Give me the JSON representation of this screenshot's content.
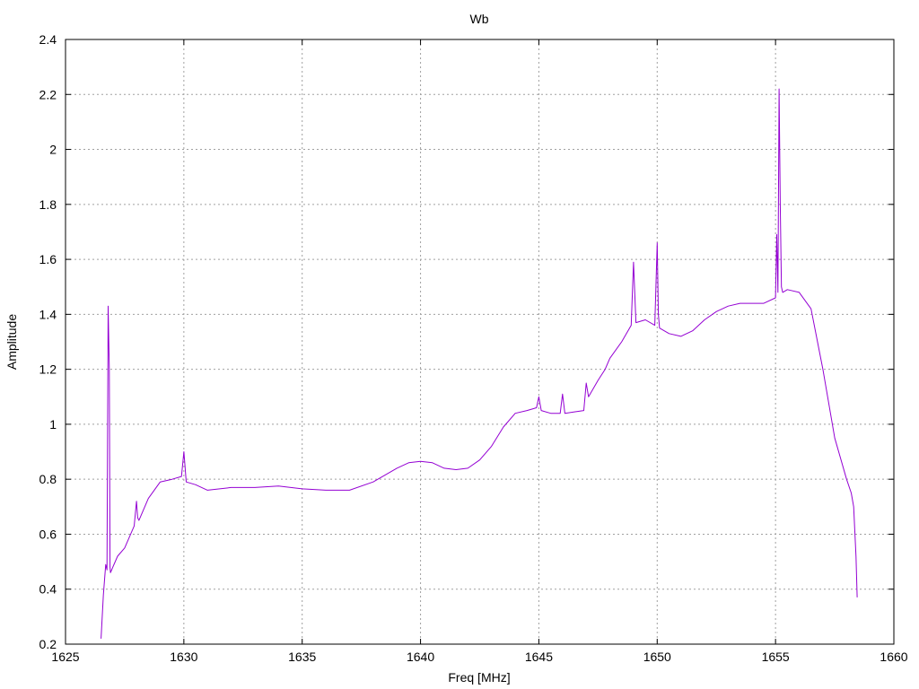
{
  "chart_data": {
    "type": "line",
    "title": "Wb",
    "xlabel": "Freq [MHz]",
    "ylabel": "Amplitude",
    "xlim": [
      1625,
      1660
    ],
    "ylim": [
      0.2,
      2.4
    ],
    "xticks": [
      1625,
      1630,
      1635,
      1640,
      1645,
      1650,
      1655,
      1660
    ],
    "yticks": [
      0.2,
      0.4,
      0.6,
      0.8,
      1,
      1.2,
      1.4,
      1.6,
      1.8,
      2,
      2.2,
      2.4
    ],
    "grid": true,
    "legend": "none",
    "series": [
      {
        "color": "#9400d3",
        "x": [
          1626.5,
          1626.6,
          1626.7,
          1626.75,
          1626.8,
          1626.85,
          1626.88,
          1626.9,
          1626.95,
          1627.0,
          1627.2,
          1627.5,
          1627.9,
          1628.0,
          1628.05,
          1628.1,
          1628.5,
          1629.0,
          1629.5,
          1629.9,
          1630.0,
          1630.1,
          1630.5,
          1631.0,
          1632.0,
          1633.0,
          1634.0,
          1635.0,
          1636.0,
          1637.0,
          1638.0,
          1639.0,
          1639.5,
          1640.0,
          1640.5,
          1641.0,
          1641.5,
          1642.0,
          1642.5,
          1643.0,
          1643.5,
          1644.0,
          1644.5,
          1644.9,
          1645.0,
          1645.1,
          1645.5,
          1645.9,
          1646.0,
          1646.1,
          1646.5,
          1646.9,
          1647.0,
          1647.1,
          1647.5,
          1647.8,
          1648.0,
          1648.5,
          1648.9,
          1649.0,
          1649.1,
          1649.5,
          1649.9,
          1650.0,
          1650.05,
          1650.1,
          1650.5,
          1651.0,
          1651.5,
          1652.0,
          1652.5,
          1653.0,
          1653.5,
          1654.0,
          1654.5,
          1655.0,
          1655.05,
          1655.1,
          1655.15,
          1655.2,
          1655.25,
          1655.3,
          1655.5,
          1656.0,
          1656.5,
          1657.0,
          1657.5,
          1658.0,
          1658.2,
          1658.3,
          1658.4,
          1658.45
        ],
        "y": [
          0.22,
          0.38,
          0.49,
          0.47,
          1.43,
          1.2,
          0.48,
          0.46,
          0.47,
          0.48,
          0.52,
          0.55,
          0.63,
          0.72,
          0.66,
          0.65,
          0.73,
          0.79,
          0.8,
          0.81,
          0.9,
          0.79,
          0.78,
          0.76,
          0.77,
          0.77,
          0.775,
          0.765,
          0.76,
          0.76,
          0.79,
          0.84,
          0.86,
          0.865,
          0.86,
          0.84,
          0.835,
          0.84,
          0.87,
          0.92,
          0.99,
          1.04,
          1.05,
          1.06,
          1.1,
          1.05,
          1.04,
          1.04,
          1.11,
          1.04,
          1.045,
          1.05,
          1.15,
          1.1,
          1.16,
          1.2,
          1.24,
          1.3,
          1.36,
          1.59,
          1.37,
          1.38,
          1.36,
          1.66,
          1.4,
          1.35,
          1.33,
          1.32,
          1.34,
          1.38,
          1.41,
          1.43,
          1.44,
          1.44,
          1.44,
          1.46,
          1.69,
          1.48,
          2.22,
          1.8,
          1.5,
          1.48,
          1.49,
          1.48,
          1.42,
          1.2,
          0.95,
          0.8,
          0.75,
          0.7,
          0.52,
          0.37
        ]
      }
    ]
  }
}
